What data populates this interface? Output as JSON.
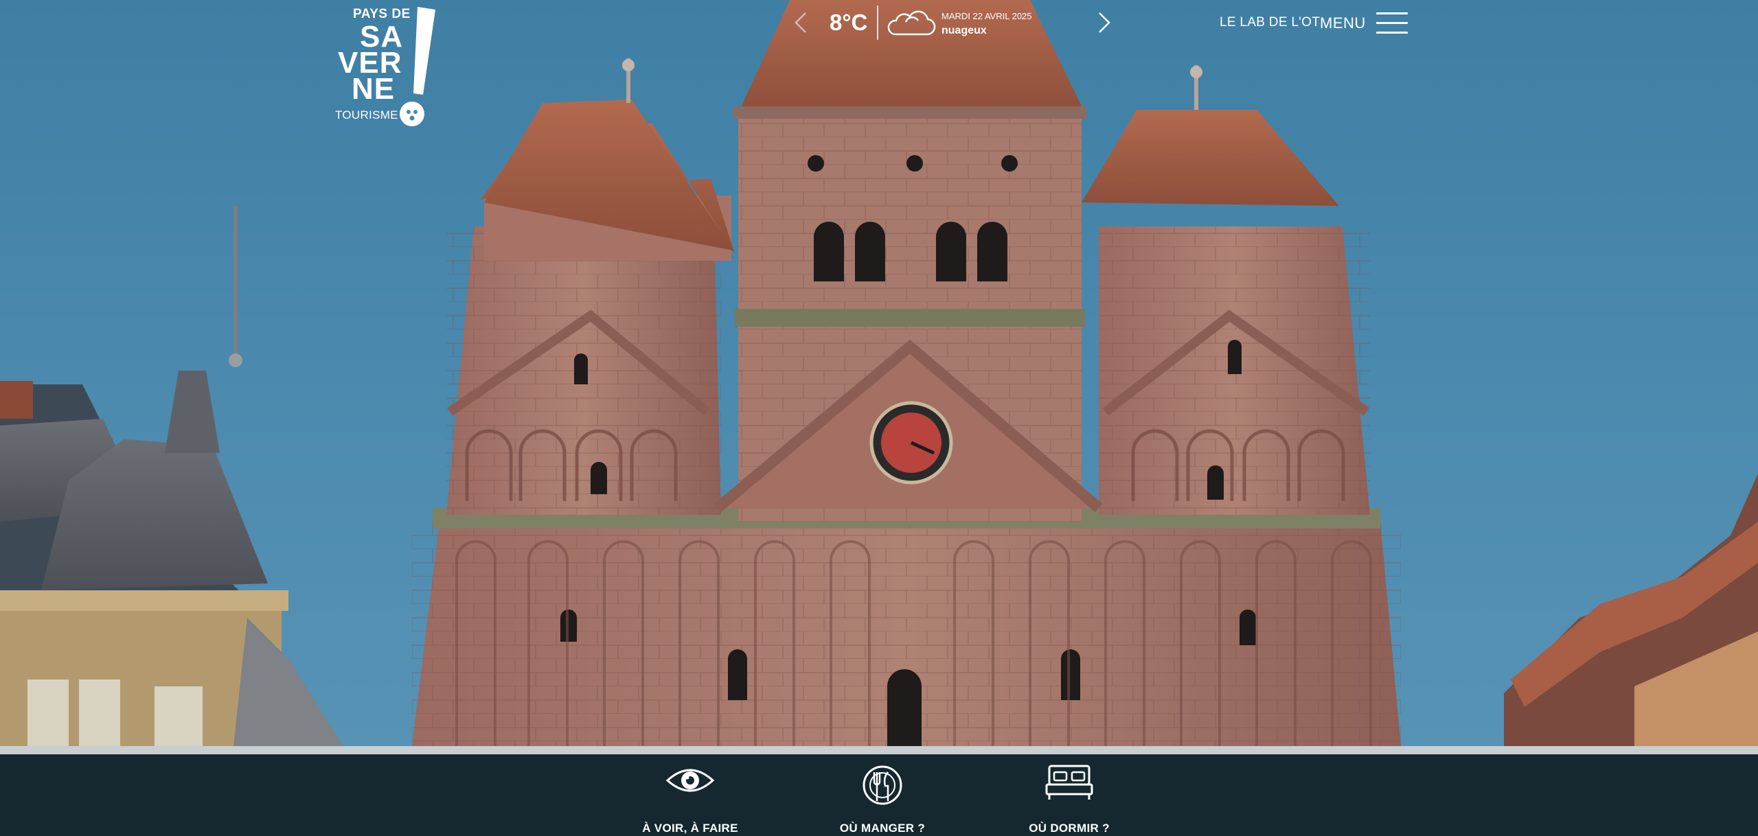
{
  "logo": {
    "line1": "PAYS DE",
    "line2": "SA",
    "line3": "VER",
    "line4": "NE",
    "line5": "TOURISME"
  },
  "weather": {
    "temperature": "8°C",
    "date": "MARDI 22 AVRIL 2025",
    "condition": "nuageux",
    "icon": "cloud-icon"
  },
  "nav": {
    "lab_link": "LE LAB DE L'OT",
    "menu_label": "MENU"
  },
  "bottom_nav": [
    {
      "label": "À VOIR, À FAIRE",
      "icon": "eye-icon"
    },
    {
      "label": "OÙ MANGER ?",
      "icon": "cutlery-icon"
    },
    {
      "label": "OÙ DORMIR ?",
      "icon": "bed-icon"
    }
  ],
  "colors": {
    "bottom_bar": "#15282f",
    "sky": "#4a88ad",
    "sandstone": "#a9746a"
  }
}
